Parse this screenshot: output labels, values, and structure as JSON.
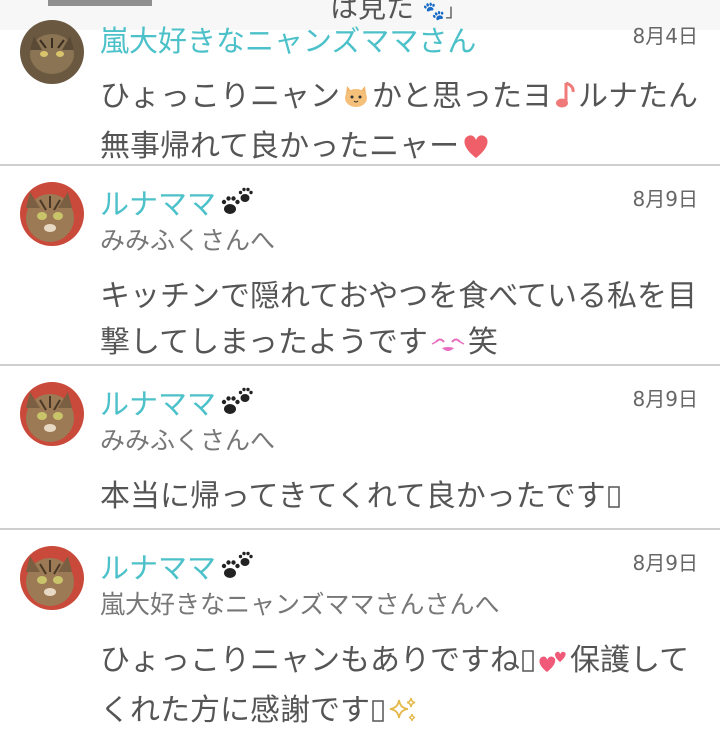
{
  "top_fragment": "は見た",
  "comments": [
    {
      "author": "嵐大好きなニャンズママさん",
      "date": "8月4日",
      "to": "",
      "body_a": "ひょっこりニャン",
      "body_b": "かと思ったヨ",
      "body_c": "ルナたん無事帰れて良かったニャー",
      "emoji": [
        "cat-face-icon",
        "music-note-icon",
        "heart-icon"
      ]
    },
    {
      "author": "ルナママ",
      "date": "8月9日",
      "to": "みみふくさんへ",
      "body_a": "キッチンで隠れておやつを食べている私を目撃してしまったようです",
      "body_b": "笑",
      "emoji": [
        "kiss-face-icon"
      ]
    },
    {
      "author": "ルナママ",
      "date": "8月9日",
      "to": "みみふくさんへ",
      "body_a": "本当に帰ってきてくれて良かったです",
      "emoji": [
        "missing-glyph-icon"
      ]
    },
    {
      "author": "ルナママ",
      "date": "8月9日",
      "to": "嵐大好きなニャンズママさんさんへ",
      "body_a": "ひょっこりニャンもありですね",
      "body_b": "保護してくれた方に感謝です",
      "emoji": [
        "missing-glyph-icon",
        "two-hearts-icon",
        "missing-glyph-icon",
        "sparkles-icon"
      ]
    }
  ],
  "colors": {
    "name": "#4cc1c9",
    "text": "#555555",
    "divider": "#cfcfcf"
  }
}
